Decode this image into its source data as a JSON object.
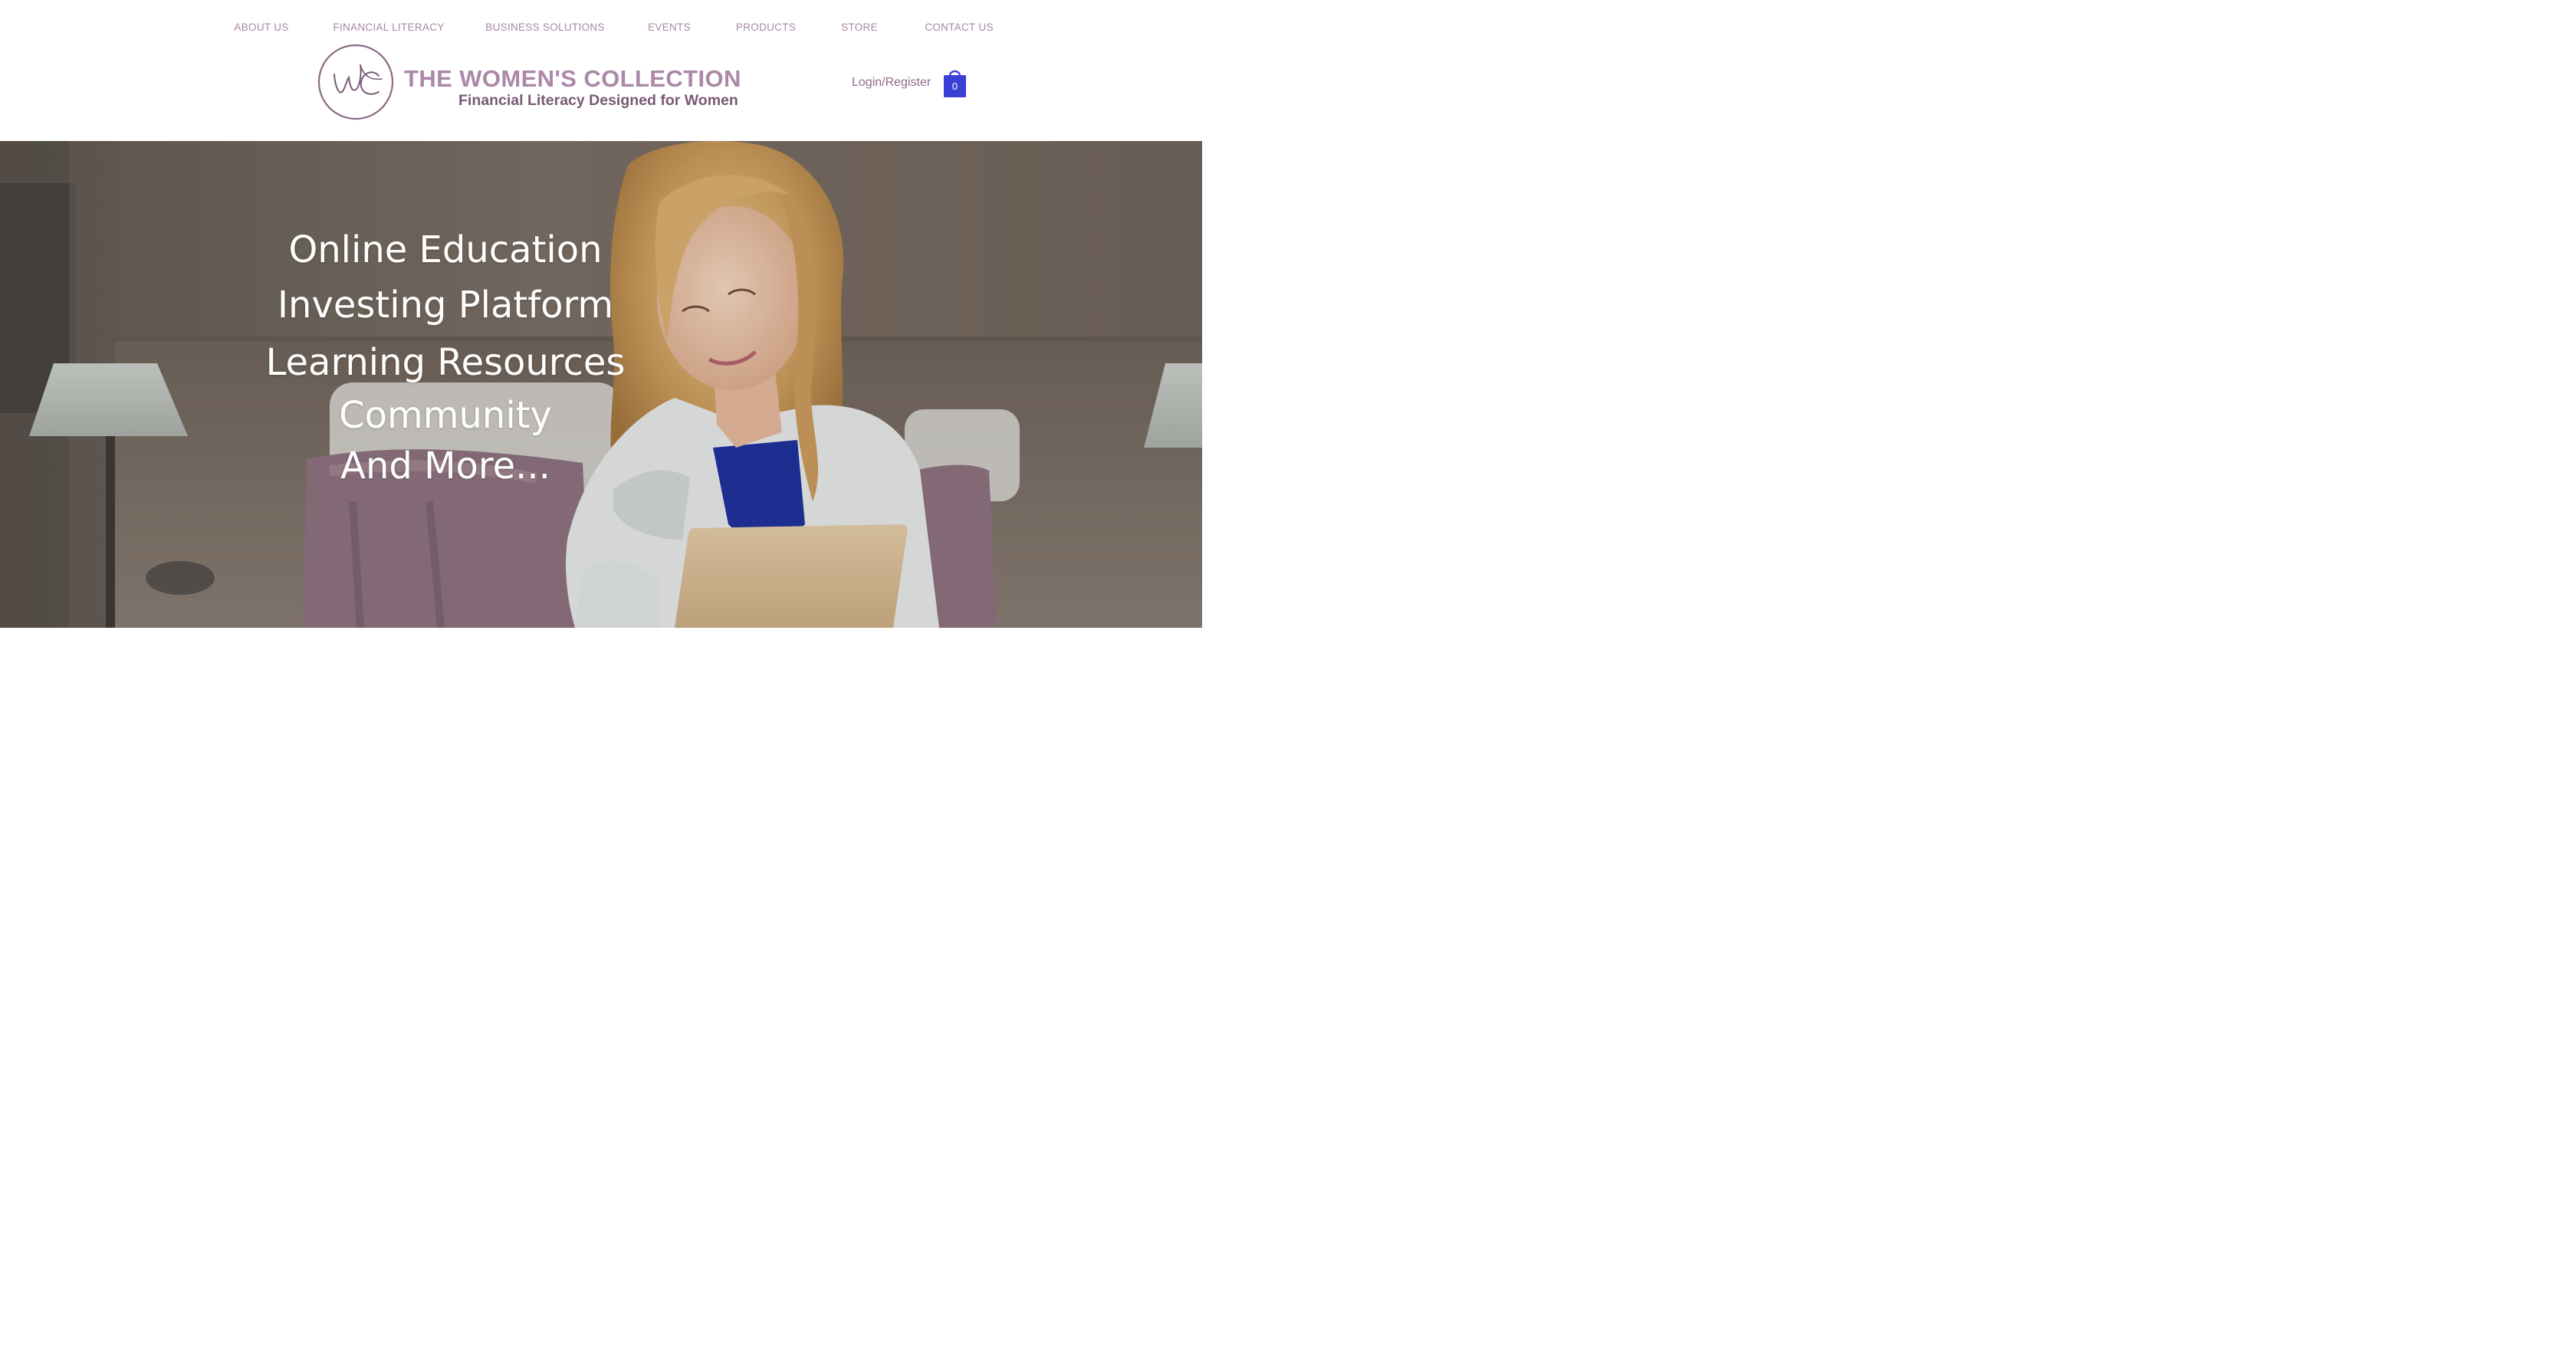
{
  "nav": {
    "items": [
      {
        "label": "ABOUT US"
      },
      {
        "label": "FINANCIAL LITERACY"
      },
      {
        "label": "BUSINESS SOLUTIONS"
      },
      {
        "label": "EVENTS"
      },
      {
        "label": "PRODUCTS"
      },
      {
        "label": "STORE"
      },
      {
        "label": "CONTACT US"
      }
    ]
  },
  "logo": {
    "title": "THE WOMEN'S COLLECTION",
    "subtitle": "Financial Literacy Designed for Women",
    "monogram": "WC"
  },
  "account": {
    "login_label": "Login/Register",
    "cart_count": "0",
    "cart_icon": "shopping-bag-icon"
  },
  "hero": {
    "lines": [
      "Online Education",
      "Investing Platform",
      "Learning Resources",
      "Community",
      "And More..."
    ]
  },
  "colors": {
    "nav_text": "#a887a4",
    "brand_mauve": "#ab88a8",
    "brand_dark": "#7a5a75",
    "cart_blue": "#3a40d6",
    "hero_text": "#ffffff"
  }
}
